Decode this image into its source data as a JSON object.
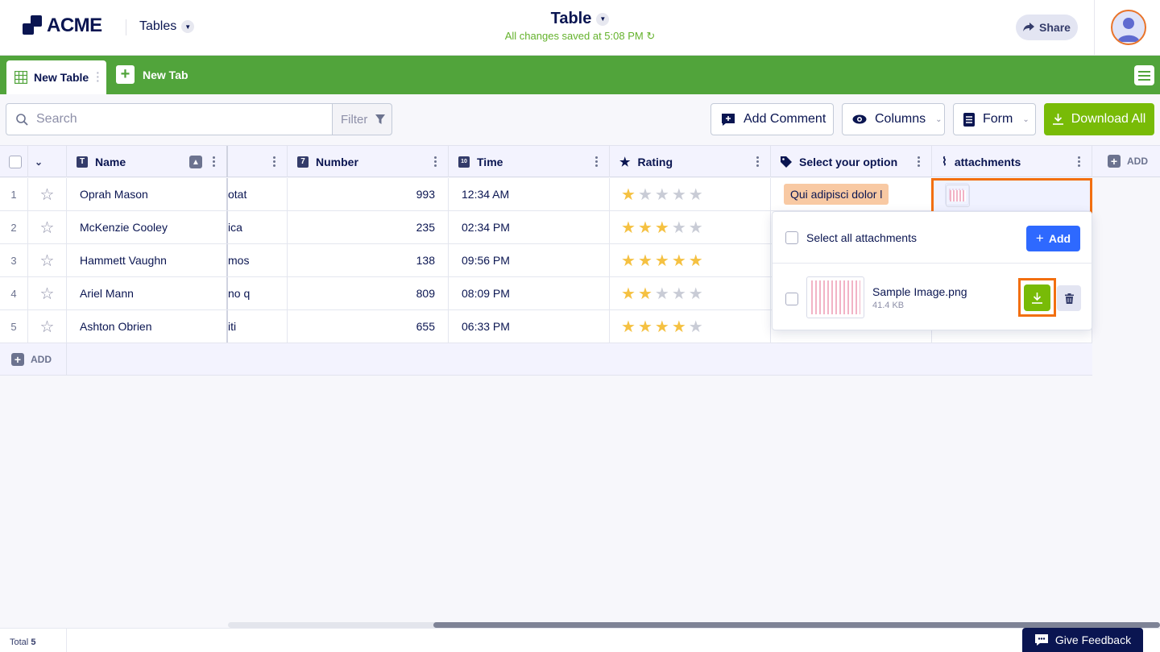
{
  "header": {
    "logo_text": "ACME",
    "nav_dropdown": "Tables",
    "title": "Table",
    "saved_status": "All changes saved at 5:08 PM",
    "share_label": "Share"
  },
  "tabs": {
    "active_tab": "New Table",
    "new_tab": "New Tab"
  },
  "toolbar": {
    "search_placeholder": "Search",
    "filter_label": "Filter",
    "add_comment": "Add Comment",
    "columns": "Columns",
    "form": "Form",
    "download_all": "Download All"
  },
  "columns": [
    "Name",
    "",
    "Number",
    "Time",
    "Rating",
    "Select your option",
    "attachments"
  ],
  "add_column_label": "ADD",
  "rows": [
    {
      "idx": "1",
      "name": "Oprah Mason",
      "c2": "otat",
      "number": "993",
      "time": "12:34 AM",
      "rating": 1,
      "option": "Qui adipisci dolor l"
    },
    {
      "idx": "2",
      "name": "McKenzie Cooley",
      "c2": "ica",
      "number": "235",
      "time": "02:34 PM",
      "rating": 3,
      "option": ""
    },
    {
      "idx": "3",
      "name": "Hammett Vaughn",
      "c2": "mos",
      "number": "138",
      "time": "09:56 PM",
      "rating": 5,
      "option": ""
    },
    {
      "idx": "4",
      "name": "Ariel Mann",
      "c2": "no q",
      "number": "809",
      "time": "08:09 PM",
      "rating": 2,
      "option": ""
    },
    {
      "idx": "5",
      "name": "Ashton Obrien",
      "c2": "iti",
      "number": "655",
      "time": "06:33 PM",
      "rating": 4,
      "option": ""
    }
  ],
  "rating_max": 5,
  "add_row_label": "ADD",
  "attachments_popover": {
    "select_all_label": "Select all attachments",
    "add_label": "Add",
    "file_name": "Sample Image.png",
    "file_size": "41.4 KB"
  },
  "footer": {
    "total_label": "Total",
    "total_count": "5",
    "feedback_label": "Give Feedback"
  },
  "colors": {
    "brand_green": "#51a43b",
    "download_green": "#78bb07",
    "primary_blue": "#2e69ff",
    "navy": "#0a1551",
    "highlight_orange": "#f26f10",
    "option_badge": "#f8c9a3"
  }
}
